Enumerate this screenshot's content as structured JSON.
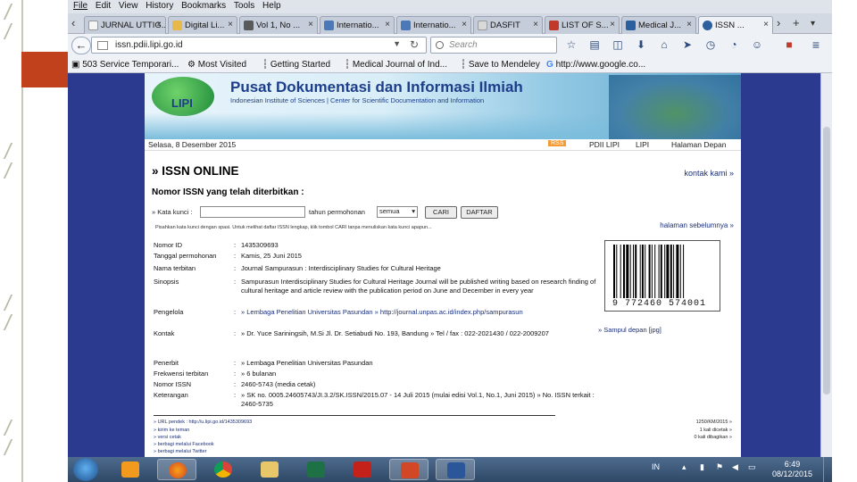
{
  "browser": {
    "menu": [
      "File",
      "Edit",
      "View",
      "History",
      "Bookmarks",
      "Tools",
      "Help"
    ],
    "tabs": [
      {
        "label": "JURNAL UTTIG...",
        "color": "#f5f5f5"
      },
      {
        "label": "Digital Li...",
        "color": "#e8b84a"
      },
      {
        "label": "Vol 1, No ...",
        "color": "#5a5a5a"
      },
      {
        "label": "Internatio...",
        "color": "#4b78b8"
      },
      {
        "label": "Internatio...",
        "color": "#4b78b8"
      },
      {
        "label": "DASFIT",
        "color": "#d9d9d9"
      },
      {
        "label": "LIST OF S...",
        "color": "#c0392b"
      },
      {
        "label": "Medical J...",
        "color": "#2c5f9e"
      },
      {
        "label": "ISSN ...",
        "color": "#2c5f9e"
      }
    ],
    "url": "issn.pdii.lipi.go.id",
    "search_placeholder": "Search",
    "bookmarks": [
      "503 Service Temporari...",
      "Most Visited",
      "Getting Started",
      "Medical Journal of Ind...",
      "Save to Mendeley",
      "http://www.google.co..."
    ]
  },
  "site": {
    "logo_text": "LIPI",
    "title": "Pusat Dokumentasi dan Informasi Ilmiah",
    "subtitle": "Indonesian Institute of Sciences | Center for Scientific Documentation and Information",
    "date": "Selasa, 8 Desember 2015",
    "nav": [
      "RSS",
      "PDII LIPI",
      "LIPI",
      "Halaman Depan"
    ],
    "heading": "» ISSN ONLINE",
    "contact": "kontak kami »",
    "subheading": "Nomor ISSN yang telah diterbitkan :",
    "form": {
      "kata_kunci_label": "» Kata kunci :",
      "tahun_label": "tahun permohonan",
      "select_value": "semua",
      "search_button": "CARI",
      "list_button": "DAFTAR"
    },
    "hint": "Pisahkan kata kunci dengan spasi. Untuk melihat daftar ISSN lengkap, klik tombol CARI tanpa menuliskan kata kunci apapun...",
    "back_link": "halaman sebelumnya »",
    "records": [
      {
        "key": "Nomor ID",
        "value": "1435309693"
      },
      {
        "key": "Tanggal permohonan",
        "value": "Kamis, 25 Juni 2015"
      },
      {
        "key": "Nama terbitan",
        "value": "Journal Sampurasun : Interdisciplinary Studies for Cultural Heritage"
      },
      {
        "key": "Sinopsis",
        "value": "Sampurasun Interdisciplinary Studies for Cultural Heritage Journal will be published writing based on research finding of cultural heritage and article review with the publication period on June and December in every year"
      },
      {
        "key": "Pengelola",
        "value": "» Lembaga Penelitian Universitas Pasundan » http://journal.unpas.ac.id/index.php/sampurasun"
      },
      {
        "key": "Kontak",
        "value": "» Dr. Yuce Sariningsih, M.Si Jl. Dr. Setiabudi No. 193, Bandung » Tel / fax : 022-2021430 / 022-2009207"
      },
      {
        "key": "Penerbit",
        "value": "» Lembaga Penelitian Universitas Pasundan"
      },
      {
        "key": "Frekwensi terbitan",
        "value": "» 6 bulanan"
      },
      {
        "key": "Nomor ISSN",
        "value": "2460-5743 (media cetak)"
      },
      {
        "key": "Keterangan",
        "value": "» SK no. 0005.24605743/JI.3.2/SK.ISSN/2015.07 - 14 Juli 2015 (mulai edisi Vol.1, No.1, Juni 2015) » No. ISSN terkait : 2460-5735"
      }
    ],
    "barcode_number": "9 772460 574001",
    "cover_link": "» Sampul depan [jpg]",
    "footer_links": [
      "» URL pendek : http://u.lipi.go.id/1435309693",
      "» kirim ke teman",
      "» versi cetak",
      "» berbagi melalui Facebook",
      "» berbagi melalui Twitter"
    ],
    "footer_stats": [
      "1250/KM/2015 »",
      "1 kali dicetak »",
      "0 kali dibagikan »"
    ]
  },
  "taskbar": {
    "apps": [
      "Windows Media Player",
      "Firefox",
      "Chrome",
      "File Explorer",
      "Excel",
      "Acrobat",
      "PowerPoint",
      "Word"
    ],
    "lang": "IN",
    "time": "6:49",
    "date": "08/12/2015"
  }
}
